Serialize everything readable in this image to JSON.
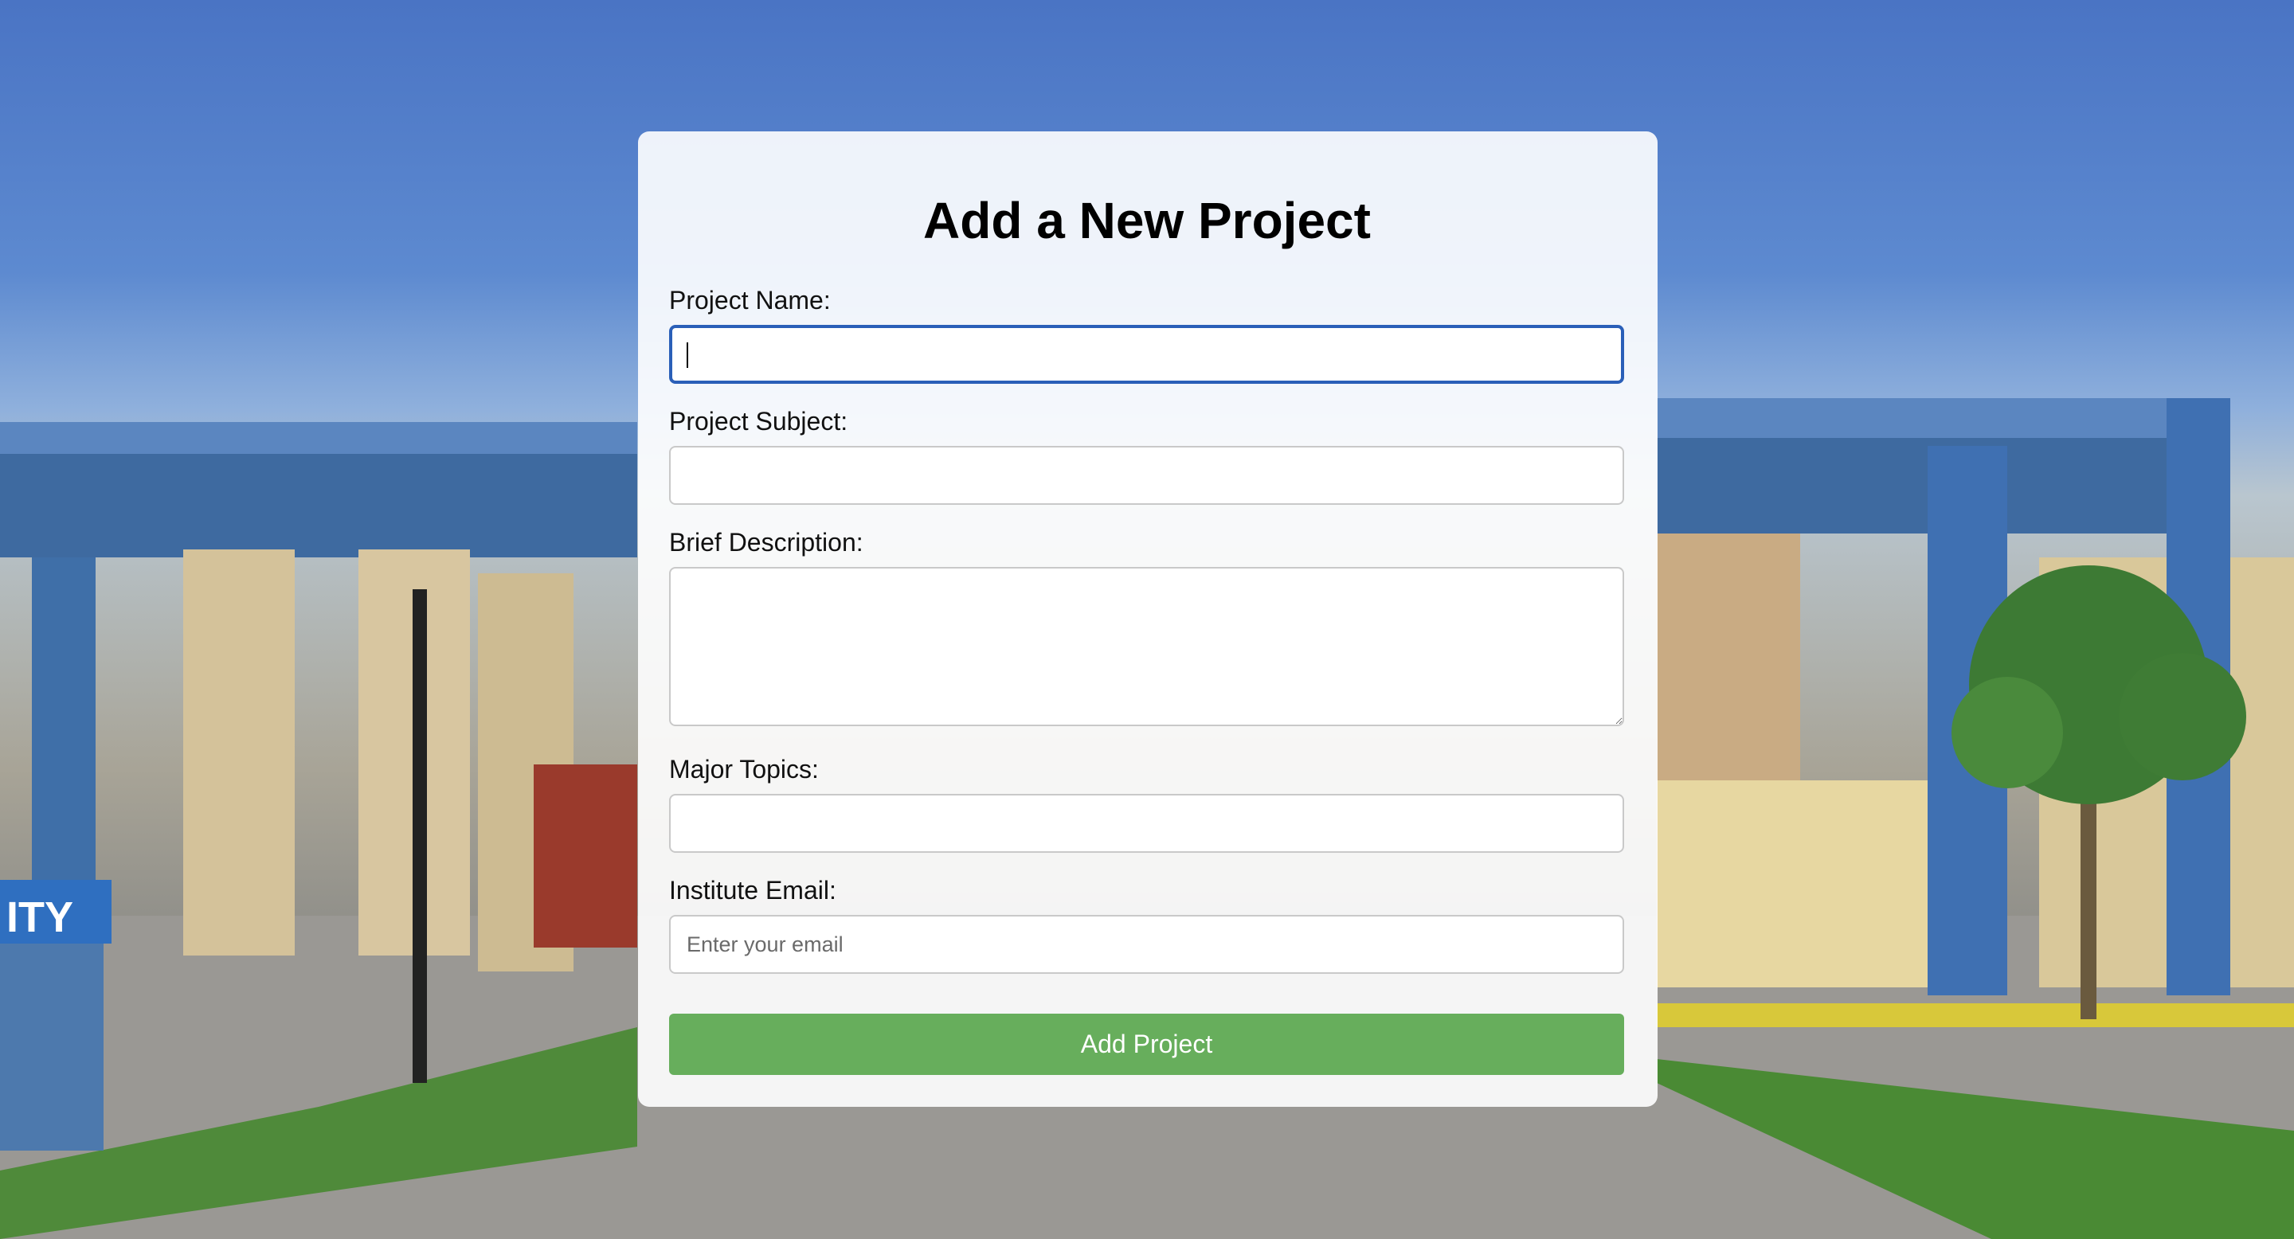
{
  "form": {
    "title": "Add a New Project",
    "fields": {
      "project_name": {
        "label": "Project Name:",
        "value": "",
        "placeholder": ""
      },
      "project_subject": {
        "label": "Project Subject:",
        "value": "",
        "placeholder": ""
      },
      "brief_description": {
        "label": "Brief Description:",
        "value": "",
        "placeholder": ""
      },
      "major_topics": {
        "label": "Major Topics:",
        "value": "",
        "placeholder": ""
      },
      "institute_email": {
        "label": "Institute Email:",
        "value": "",
        "placeholder": "Enter your email"
      }
    },
    "submit_label": "Add Project"
  },
  "background": {
    "sign_text": "ITY"
  },
  "colors": {
    "submit_button": "#67ae5c",
    "focus_border": "#2a5fb8"
  }
}
